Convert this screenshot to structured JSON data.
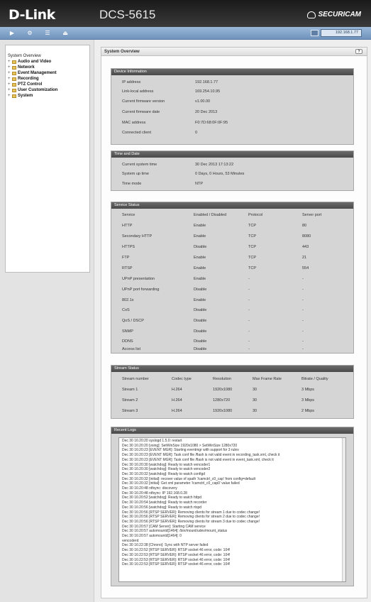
{
  "header": {
    "logo": "D-Link",
    "model": "DCS-5615",
    "brand": "SECURICAM"
  },
  "toolbar": {
    "buttons": [
      "live-video",
      "setup",
      "maintenance",
      "logout"
    ],
    "ip": "192.168.1.77"
  },
  "sidebar": {
    "root": "System Overview",
    "items": [
      "Audio and Video",
      "Network",
      "Event Management",
      "Recording",
      "PTZ Control",
      "User Customization",
      "System"
    ]
  },
  "main": {
    "title": "System Overview"
  },
  "device_info": {
    "title": "Device Information",
    "rows": [
      {
        "label": "IP address",
        "value": "192.168.1.77"
      },
      {
        "label": "Link-local address",
        "value": "169.254.10.95"
      },
      {
        "label": "Current firmware version",
        "value": "v1.00.00"
      },
      {
        "label": "Current firmware date",
        "value": "20 Dec 2013"
      },
      {
        "label": "MAC address",
        "value": "F0:7D:68:0F:0F:95"
      },
      {
        "label": "Connected client",
        "value": "0"
      }
    ]
  },
  "time_info": {
    "title": "Time and Date",
    "rows": [
      {
        "label": "Current system time",
        "value": "30 Dec 2013 17:13:22"
      },
      {
        "label": "System up time",
        "value": "0 Days, 0 Hours, 53 Minutes"
      },
      {
        "label": "Time mode",
        "value": "NTP"
      }
    ]
  },
  "service_status": {
    "title": "Service Status",
    "headers": [
      "Service",
      "Enabled / Disabled",
      "Protocol",
      "Server port"
    ],
    "rows": [
      [
        "HTTP",
        "Enable",
        "TCP",
        "80"
      ],
      [
        "Secondary HTTP",
        "Enable",
        "TCP",
        "8080"
      ],
      [
        "HTTPS",
        "Disable",
        "TCP",
        "443"
      ],
      [
        "FTP",
        "Enable",
        "TCP",
        "21"
      ],
      [
        "RTSP",
        "Enable",
        "TCP",
        "554"
      ],
      [
        "UPnP presentation",
        "Enable",
        "-",
        "-"
      ],
      [
        "UPnP port forwarding",
        "Disable",
        "-",
        "-"
      ],
      [
        "802.1x",
        "Enable",
        "-",
        "-"
      ],
      [
        "CoS",
        "Disable",
        "-",
        "-"
      ],
      [
        "QoS / DSCP",
        "Disable",
        "-",
        "-"
      ],
      [
        "SNMP",
        "Disable",
        "-",
        "-"
      ],
      [
        "DDNS",
        "Disable",
        "-",
        "-"
      ],
      [
        "Access list",
        "Disable",
        "-",
        "-"
      ]
    ]
  },
  "stream_status": {
    "title": "Stream Status",
    "headers": [
      "Stream number",
      "Codec type",
      "Resolution",
      "Max Frame Rate",
      "Bitrate / Quality"
    ],
    "rows": [
      [
        "Stream 1",
        "H.264",
        "1920x1080",
        "30",
        "3 Mbps"
      ],
      [
        "Stream 2",
        "H.264",
        "1280x720",
        "30",
        "3 Mbps"
      ],
      [
        "Stream 3",
        "H.264",
        "1920x1080",
        "30",
        "2 Mbps"
      ]
    ]
  },
  "recent_logs": {
    "title": "Recent Logs",
    "lines": [
      "Dec 30 16:20:20 syslogd 1.5.0: restart",
      "Dec 30 16:20:20 [vsing]: SetWinSize 1920x1080 > SetWinSize 1280x720",
      "Dec 30 16:20:23 [EVENT MGR]: Starting eventmgr with support for 3 rules",
      "Dec 30 16:20:23 [EVENT MGR]: Task conf file /flash is not valid event in recording_task.xml, check it",
      "Dec 30 16:20:23 [EVENT MGR]: Task conf file /flash is not valid event in event_task.xml, check it",
      "Dec 30 16:20:30 [watchdog]: Ready to watch vencoder1",
      "Dec 30 16:20:30 [watchdog]: Ready to watch vencoder2",
      "Dec 30 16:20:32 [watchdog]: Ready to watch configd",
      "Dec 30 16:20:32 [initial]: recover value of xpath '/camctrl_c0_cap' from config=default",
      "Dec 30 16:20:32 [initial]: Get xml parameter '/camctrl_c0_cap0' value failed",
      "Dec 30 16:20:48 ntfsync: discovery",
      "Dec 30 16:20:48 ntfsync: IP 192.168.0.28",
      "Dec 30 16:20:52 [watchdog]: Ready to watch httpd",
      "Dec 30 16:20:54 [watchdog]: Ready to watch recorder",
      "Dec 30 16:20:56 [watchdog]: Ready to watch rtspd",
      "Dec 30 16:20:56 [RTSP SERVER]: Removing clients for stream 1 due to codec change!",
      "Dec 30 16:20:56 [RTSP SERVER]: Removing clients for stream 2 due to codec change!",
      "Dec 30 16:20:56 [RTSP SERVER]: Removing clients for stream 3 due to codec change!",
      "Dec 30 16:20:57 [CAM Server]: Starting CAM service",
      "Dec 30 16:20:57 automountd[1464]: /bin/mount/udev/mount_status",
      "Dec 30 16:20:57 automountd[1464]: 0",
      "vencoderd",
      "Dec 30 16:22:38 [Chrono]: Sync with NTP server failed",
      "Dec 30 16:22:52 [RTSP SERVER]: RTSP socket 46 error, code: 104!",
      "Dec 30 16:22:53 [RTSP SERVER]: RTSP socket 46 error, code: 104!",
      "Dec 30 16:22:53 [RTSP SERVER]: RTSP socket 46 error, code: 104!",
      "Dec 30 16:22:53 [RTSP SERVER]: RTSP socket 46 error, code: 104!"
    ]
  }
}
